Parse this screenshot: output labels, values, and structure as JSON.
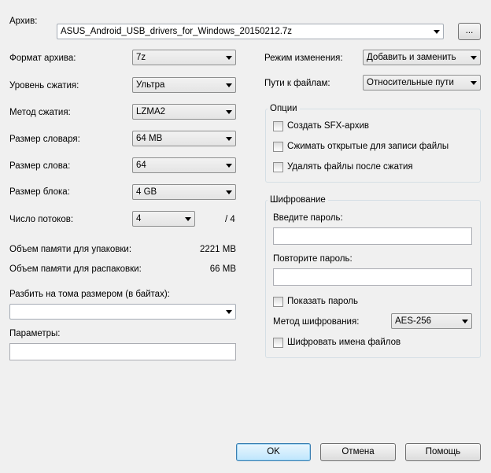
{
  "archive": {
    "label": "Архив:",
    "value": "ASUS_Android_USB_drivers_for_Windows_20150212.7z",
    "browse_label": "..."
  },
  "left": {
    "format": {
      "label": "Формат архива:",
      "value": "7z"
    },
    "level": {
      "label": "Уровень сжатия:",
      "value": "Ультра"
    },
    "method": {
      "label": "Метод сжатия:",
      "value": "LZMA2"
    },
    "dict": {
      "label": "Размер словаря:",
      "value": "64 MB"
    },
    "word": {
      "label": "Размер слова:",
      "value": "64"
    },
    "block": {
      "label": "Размер блока:",
      "value": "4 GB"
    },
    "threads": {
      "label": "Число потоков:",
      "value": "4",
      "max": "/ 4"
    },
    "mem_pack": {
      "label": "Объем памяти для упаковки:",
      "value": "2221 MB"
    },
    "mem_unpack": {
      "label": "Объем памяти для распаковки:",
      "value": "66 MB"
    },
    "split": {
      "label": "Разбить на тома размером (в байтах):",
      "value": ""
    },
    "params": {
      "label": "Параметры:",
      "value": ""
    }
  },
  "right": {
    "mode": {
      "label": "Режим изменения:",
      "value": "Добавить и заменить"
    },
    "paths": {
      "label": "Пути к файлам:",
      "value": "Относительные пути"
    },
    "options": {
      "title": "Опции",
      "sfx": "Создать SFX-архив",
      "shared": "Сжимать открытые для записи файлы",
      "delete": "Удалять файлы после сжатия"
    },
    "encryption": {
      "title": "Шифрование",
      "password_label": "Введите пароль:",
      "repeat_label": "Повторите пароль:",
      "show_password": "Показать пароль",
      "method_label": "Метод шифрования:",
      "method_value": "AES-256",
      "encrypt_names": "Шифровать имена файлов"
    }
  },
  "buttons": {
    "ok": "OK",
    "cancel": "Отмена",
    "help": "Помощь"
  }
}
